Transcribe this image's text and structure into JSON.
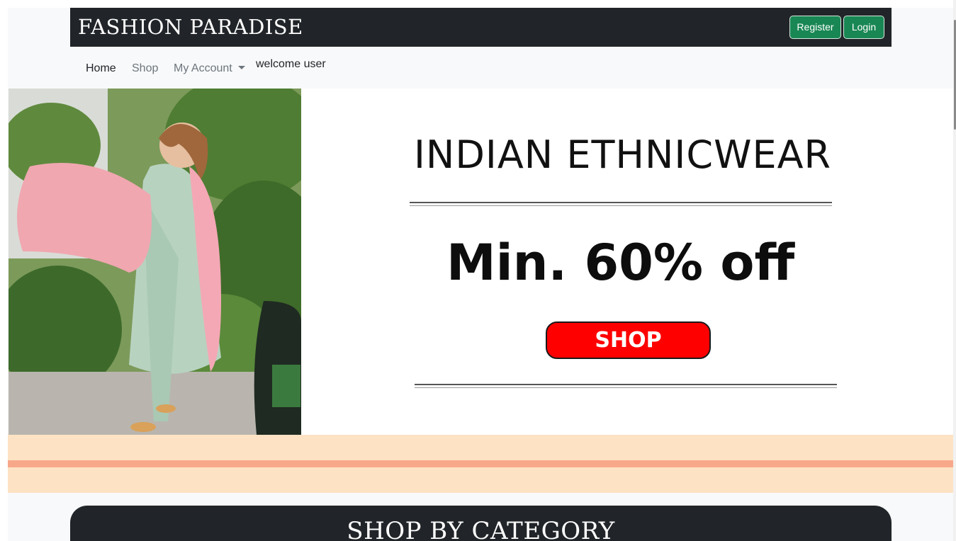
{
  "header": {
    "brand": "FASHION PARADISE",
    "register_label": "Register",
    "login_label": "Login"
  },
  "nav": {
    "items": [
      {
        "label": "Home"
      },
      {
        "label": "Shop"
      },
      {
        "label": "My Account"
      }
    ],
    "welcome": "welcome user"
  },
  "banner": {
    "headline": "INDIAN ETHNICWEAR",
    "offer": "Min. 60% off",
    "cta": "SHOP"
  },
  "category": {
    "title": "SHOP BY CATEGORY"
  },
  "colors": {
    "dark": "#212529",
    "button_green": "#198754",
    "cta_red": "#ff0000",
    "strip_peach": "#fde2c4",
    "strip_line": "#f8a88a"
  }
}
